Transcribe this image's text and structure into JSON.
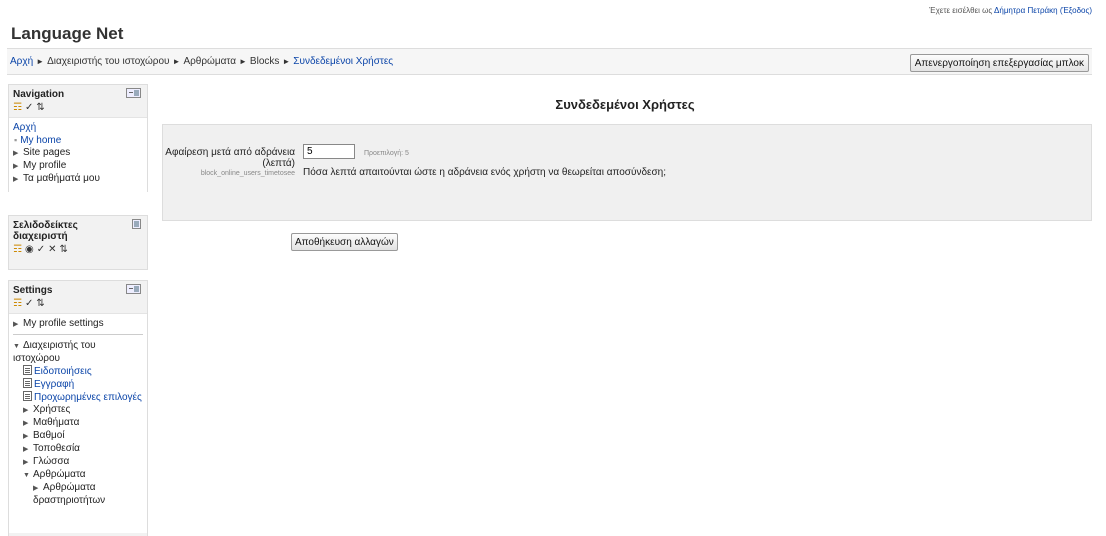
{
  "header": {
    "site_title": "Language Net",
    "login_prefix": "Έχετε εισέλθει ως ",
    "user_name": "Δήμητρα Πετράκη",
    "logout_label": "(Έξοδος)"
  },
  "breadcrumb": {
    "items": [
      "Αρχή",
      "Διαχειριστής του ιστοχώρου",
      "Αρθρώματα",
      "Blocks",
      "Συνδεδεμένοι Χρήστες"
    ],
    "separator": "►"
  },
  "edit_button_label": "Απενεργοποίηση επεξεργασίας μπλοκ",
  "navigation_block": {
    "title": "Navigation",
    "items": [
      "Αρχή",
      "My home",
      "Site pages",
      "My profile",
      "Τα μαθήματά μου"
    ]
  },
  "admin_bookmarks_block": {
    "title": "Σελιδοδείκτες διαχειριστή"
  },
  "settings_block": {
    "title": "Settings",
    "profile_settings": "My profile settings",
    "site_admin": "Διαχειριστής του ιστοχώρου",
    "items": [
      "Ειδοποιήσεις",
      "Εγγραφή",
      "Προχωρημένες επιλογές",
      "Χρήστες",
      "Μαθήματα",
      "Βαθμοί",
      "Τοποθεσία",
      "Γλώσσα",
      "Αρθρώματα",
      "Αρθρώματα δραστηριοτήτων"
    ]
  },
  "main": {
    "heading": "Συνδεδεμένοι Χρήστες",
    "field_label": "Αφαίρεση μετά από αδράνεια (λεπτά)",
    "field_key": "block_online_users_timetosee",
    "field_value": "5",
    "default_note": "Προεπιλογή: 5",
    "field_description": "Πόσα λεπτά απαιτούνται ώστε η αδράνεια ενός χρήστη να θεωρείται αποσύνδεση;",
    "save_label": "Αποθήκευση αλλαγών"
  }
}
